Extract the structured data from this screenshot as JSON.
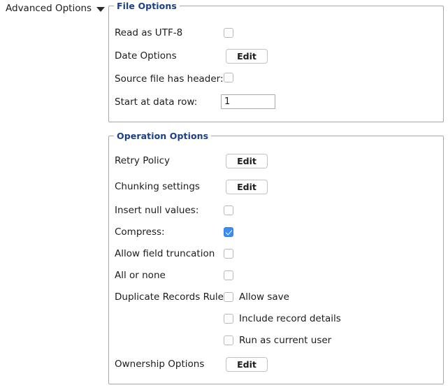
{
  "disclosure": {
    "label": "Advanced Options",
    "icon": "chevron-down-icon",
    "expanded": true
  },
  "colors": {
    "group_title": "#1b3f87",
    "checkbox_checked": "#3b8cf4",
    "border": "#a8a8a8",
    "background": "#ffffff"
  },
  "file_options": {
    "title": "File Options",
    "rows": [
      {
        "label": "Read as UTF-8",
        "control": "checkbox",
        "checked": false
      },
      {
        "label": "Date Options",
        "control": "button",
        "button_label": "Edit"
      },
      {
        "label": "Source file has header:",
        "control": "checkbox",
        "checked": false
      },
      {
        "label": "Start at data row:",
        "control": "textfield",
        "value": "1"
      }
    ]
  },
  "operation_options": {
    "title": "Operation Options",
    "rows": [
      {
        "label": "Retry Policy",
        "control": "button",
        "button_label": "Edit"
      },
      {
        "label": "Chunking settings",
        "control": "button",
        "button_label": "Edit"
      },
      {
        "label": "Insert null values:",
        "control": "checkbox",
        "checked": false
      },
      {
        "label": "Compress:",
        "control": "checkbox",
        "checked": true
      },
      {
        "label": "Allow field truncation",
        "control": "checkbox",
        "checked": false
      },
      {
        "label": "All or none",
        "control": "checkbox",
        "checked": false
      },
      {
        "label": "Duplicate Records Rule",
        "control": "checkbox-label",
        "checked": false,
        "option_label": "Allow save"
      },
      {
        "label": "",
        "control": "checkbox-label",
        "checked": false,
        "option_label": "Include record details"
      },
      {
        "label": "",
        "control": "checkbox-label",
        "checked": false,
        "option_label": "Run as current user"
      },
      {
        "label": "Ownership Options",
        "control": "button",
        "button_label": "Edit"
      }
    ]
  }
}
